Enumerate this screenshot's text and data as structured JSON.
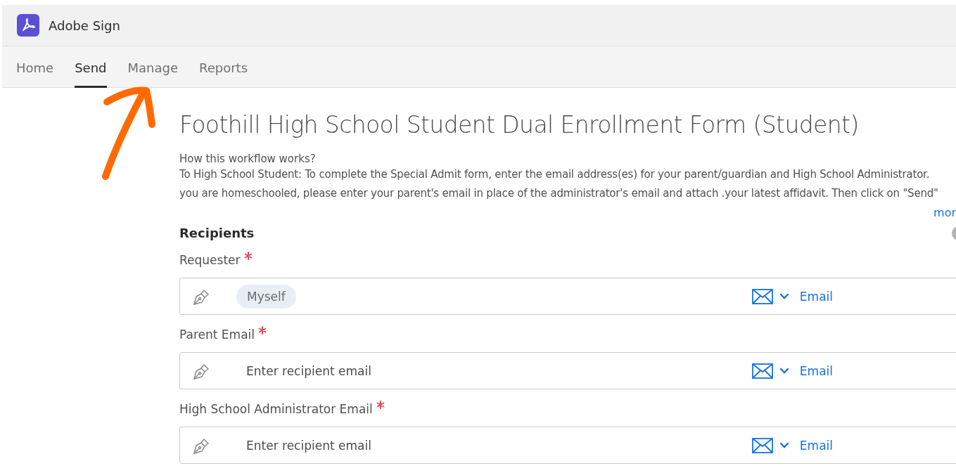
{
  "app": {
    "name": "Adobe Sign"
  },
  "tabs": [
    {
      "label": "Home",
      "selected": false
    },
    {
      "label": "Send",
      "selected": true
    },
    {
      "label": "Manage",
      "selected": false
    },
    {
      "label": "Reports",
      "selected": false
    }
  ],
  "form": {
    "title": "Foothill High School Student Dual Enrollment Form (Student)",
    "intro": "How this workflow works?",
    "description_lines": [
      "To High School Student: To complete the Special Admit form, enter the email address(es) for your parent/guardian and High School Administrator.",
      "you are homeschooled, please enter your parent's email in place of the administrator's email and attach .your latest affidavit. Then click on \"Send\""
    ],
    "more_link": "mor"
  },
  "recipients": {
    "heading": "Recipients",
    "fields": [
      {
        "label": "Requester",
        "required": true,
        "kind": "chip",
        "value": "Myself",
        "method": "Email"
      },
      {
        "label": "Parent Email",
        "required": true,
        "kind": "input",
        "placeholder": "Enter recipient email",
        "method": "Email"
      },
      {
        "label": "High School Administrator Email",
        "required": true,
        "kind": "input",
        "placeholder": "Enter recipient email",
        "method": "Email"
      }
    ]
  }
}
